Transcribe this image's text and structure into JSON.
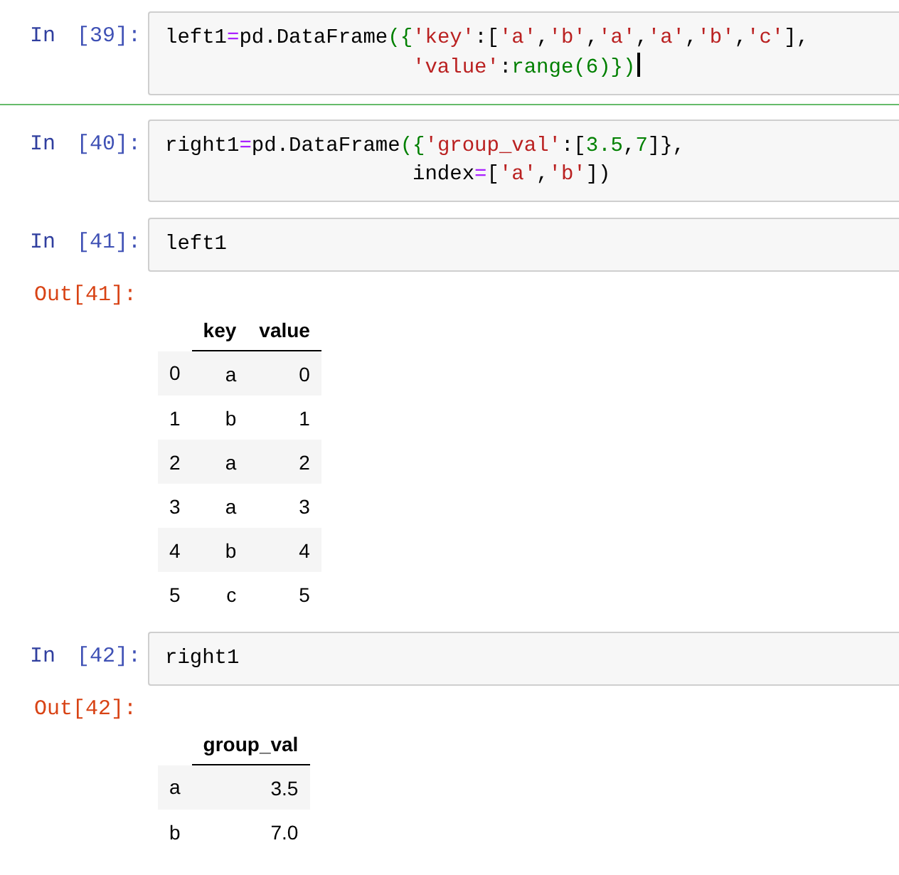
{
  "cells": [
    {
      "prompt_kind": "In",
      "prompt_number": "[39]:",
      "selected": true,
      "code": [
        {
          "hanging": false,
          "tokens": [
            {
              "kind": "plain",
              "text": "left1"
            },
            {
              "kind": "op",
              "text": "="
            },
            {
              "kind": "plain",
              "text": "pd.DataFrame"
            },
            {
              "kind": "bracket",
              "text": "({"
            },
            {
              "kind": "string",
              "text": "'key'"
            },
            {
              "kind": "plain",
              "text": ":["
            },
            {
              "kind": "string",
              "text": "'a'"
            },
            {
              "kind": "plain",
              "text": ","
            },
            {
              "kind": "string",
              "text": "'b'"
            },
            {
              "kind": "plain",
              "text": ","
            },
            {
              "kind": "string",
              "text": "'a'"
            },
            {
              "kind": "plain",
              "text": ","
            },
            {
              "kind": "string",
              "text": "'a'"
            },
            {
              "kind": "plain",
              "text": ","
            },
            {
              "kind": "string",
              "text": "'b'"
            },
            {
              "kind": "plain",
              "text": ","
            },
            {
              "kind": "string",
              "text": "'c'"
            },
            {
              "kind": "plain",
              "text": "],"
            }
          ]
        },
        {
          "hanging": true,
          "tokens": [
            {
              "kind": "string",
              "text": "'value'"
            },
            {
              "kind": "plain",
              "text": ":"
            },
            {
              "kind": "builtin",
              "text": "range"
            },
            {
              "kind": "bracket",
              "text": "("
            },
            {
              "kind": "number",
              "text": "6"
            },
            {
              "kind": "bracket",
              "text": ")})"
            }
          ]
        }
      ]
    },
    {
      "prompt_kind": "In",
      "prompt_number": "[40]:",
      "selected": false,
      "code": [
        {
          "hanging": false,
          "tokens": [
            {
              "kind": "plain",
              "text": "right1"
            },
            {
              "kind": "op",
              "text": "="
            },
            {
              "kind": "plain",
              "text": "pd.DataFrame"
            },
            {
              "kind": "bracket",
              "text": "({"
            },
            {
              "kind": "string",
              "text": "'group_val'"
            },
            {
              "kind": "plain",
              "text": ":["
            },
            {
              "kind": "number",
              "text": "3.5"
            },
            {
              "kind": "plain",
              "text": ","
            },
            {
              "kind": "number",
              "text": "7"
            },
            {
              "kind": "plain",
              "text": "]},"
            }
          ]
        },
        {
          "hanging": true,
          "tokens": [
            {
              "kind": "plain",
              "text": "index"
            },
            {
              "kind": "op",
              "text": "="
            },
            {
              "kind": "plain",
              "text": "["
            },
            {
              "kind": "string",
              "text": "'a'"
            },
            {
              "kind": "plain",
              "text": ","
            },
            {
              "kind": "string",
              "text": "'b'"
            },
            {
              "kind": "plain",
              "text": "])"
            }
          ]
        }
      ]
    },
    {
      "prompt_kind": "In",
      "prompt_number": "[41]:",
      "selected": false,
      "code": [
        {
          "hanging": false,
          "tokens": [
            {
              "kind": "plain",
              "text": "left1"
            }
          ]
        }
      ],
      "output": {
        "prompt": "Out[41]:",
        "columns": [
          "key",
          "value"
        ],
        "rows": [
          {
            "index": "0",
            "values": [
              "a",
              "0"
            ]
          },
          {
            "index": "1",
            "values": [
              "b",
              "1"
            ]
          },
          {
            "index": "2",
            "values": [
              "a",
              "2"
            ]
          },
          {
            "index": "3",
            "values": [
              "a",
              "3"
            ]
          },
          {
            "index": "4",
            "values": [
              "b",
              "4"
            ]
          },
          {
            "index": "5",
            "values": [
              "c",
              "5"
            ]
          }
        ]
      }
    },
    {
      "prompt_kind": "In",
      "prompt_number": "[42]:",
      "selected": false,
      "code": [
        {
          "hanging": false,
          "tokens": [
            {
              "kind": "plain",
              "text": "right1"
            }
          ]
        }
      ],
      "output": {
        "prompt": "Out[42]:",
        "columns": [
          "group_val"
        ],
        "rows": [
          {
            "index": "a",
            "values": [
              "3.5"
            ]
          },
          {
            "index": "b",
            "values": [
              "7.0"
            ]
          }
        ]
      }
    }
  ]
}
